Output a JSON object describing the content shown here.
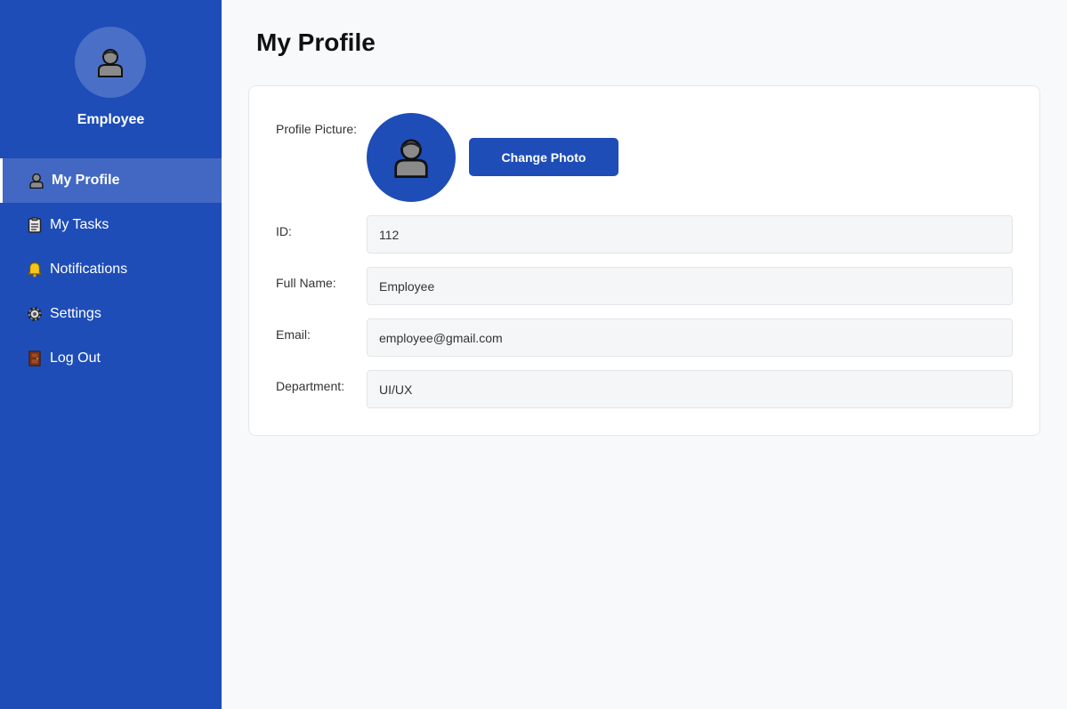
{
  "sidebar": {
    "avatar_icon": "person-icon",
    "user_name": "Employee",
    "items": [
      {
        "label": "My Profile",
        "icon": "person-icon",
        "active": true
      },
      {
        "label": "My Tasks",
        "icon": "clipboard-icon"
      },
      {
        "label": "Notifications",
        "icon": "bell-icon"
      },
      {
        "label": "Settings",
        "icon": "gear-icon"
      },
      {
        "label": "Log Out",
        "icon": "door-icon"
      }
    ]
  },
  "main": {
    "title": "My Profile",
    "profile": {
      "picture_label": "Profile Picture:",
      "change_photo_label": "Change Photo",
      "id_label": "ID:",
      "id_value": "112",
      "name_label": "Full Name:",
      "name_value": "Employee",
      "email_label": "Email:",
      "email_value": "employee@gmail.com",
      "department_label": "Department:",
      "department_value": "UI/UX"
    }
  },
  "colors": {
    "sidebar": "#1e4db7",
    "active_item": "#4268c3",
    "accent": "#1e4db7",
    "background": "#f8f9fa"
  }
}
